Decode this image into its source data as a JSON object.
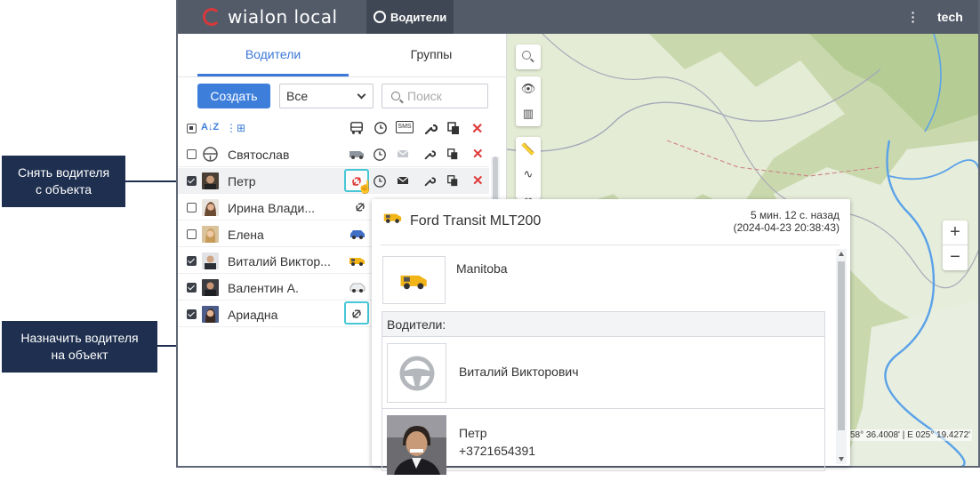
{
  "header": {
    "logo_text": "wialon local",
    "nav_active": "Водители",
    "user": "tech"
  },
  "tabs": [
    {
      "label": "Водители",
      "active": true
    },
    {
      "label": "Группы",
      "active": false
    }
  ],
  "toolbar": {
    "create_label": "Создать",
    "filter_value": "Все",
    "search_placeholder": "Поиск",
    "sort_icon_label": "A↓Z",
    "sms_label": "SMS"
  },
  "drivers": [
    {
      "name": "Святослав",
      "checked": false,
      "avatar": "steering-wheel",
      "unit": "gray-van"
    },
    {
      "name": "Петр",
      "checked": true,
      "avatar": "photo",
      "unit": "unbind"
    },
    {
      "name": "Ирина Влади...",
      "checked": false,
      "avatar": "photo",
      "unit": "bind"
    },
    {
      "name": "Елена",
      "checked": false,
      "avatar": "photo",
      "unit": "blue-car"
    },
    {
      "name": "Виталий Виктор...",
      "checked": true,
      "avatar": "photo",
      "unit": "yellow-van"
    },
    {
      "name": "Валентин А.",
      "checked": true,
      "avatar": "photo",
      "unit": "white-car"
    },
    {
      "name": "Ариадна",
      "checked": true,
      "avatar": "photo",
      "unit": "bind"
    }
  ],
  "map": {
    "coords": "58° 36.4008' | E 025° 19.4272'",
    "zoom_in": "+",
    "zoom_out": "−"
  },
  "popup": {
    "unit_name": "Ford Transit MLT200",
    "time_ago": "5 мин. 12 с. назад",
    "timestamp": "(2024-04-23 20:38:43)",
    "location": "Manitoba",
    "drivers_header": "Водители:",
    "drivers": [
      {
        "name": "Виталий Викторович",
        "phone": ""
      },
      {
        "name": "Петр",
        "phone": "+3721654391"
      }
    ]
  },
  "callouts": {
    "remove": "Снять водителя\nс объекта",
    "assign": "Назначить водителя\nна объект"
  },
  "colors": {
    "topbar": "#535b69",
    "accent": "#3d7edb",
    "callout": "#1e2f4f",
    "highlight": "#47c7d6",
    "delete": "#e03b3b"
  }
}
